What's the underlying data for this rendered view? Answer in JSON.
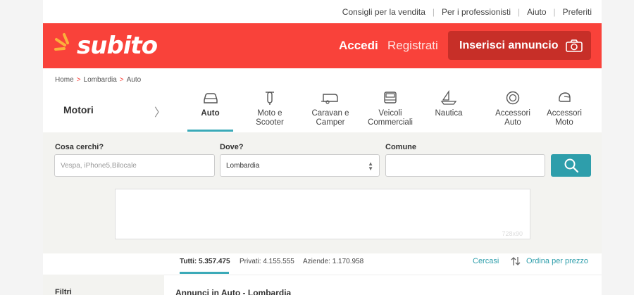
{
  "topbar": {
    "links": [
      "Consigli per la vendita",
      "Per i professionisti",
      "Aiuto",
      "Preferiti"
    ]
  },
  "header": {
    "logo": "subito",
    "login": "Accedi",
    "register": "Registrati",
    "cta": "Inserisci annuncio",
    "bg_color": "#f9423a"
  },
  "breadcrumb": [
    "Home",
    "Lombardia",
    "Auto"
  ],
  "categories": {
    "section": "Motori",
    "items": [
      {
        "label": "Auto",
        "icon": "car-icon",
        "active": true
      },
      {
        "label": "Moto e\nScooter",
        "icon": "scooter-icon"
      },
      {
        "label": "Caravan e\nCamper",
        "icon": "caravan-icon"
      },
      {
        "label": "Veicoli\nCommerciali",
        "icon": "van-icon"
      },
      {
        "label": "Nautica",
        "icon": "boat-icon"
      },
      {
        "label": "Accessori\nAuto",
        "icon": "wheel-icon"
      },
      {
        "label": "Accessori\nMoto",
        "icon": "helmet-icon"
      }
    ]
  },
  "search": {
    "what_label": "Cosa cerchi?",
    "what_placeholder": "Vespa, iPhone5,Bilocale",
    "where_label": "Dove?",
    "where_value": "Lombardia",
    "comune_label": "Comune",
    "comune_value": "",
    "button_color": "#2e9eab"
  },
  "ad": {
    "size": "728x90"
  },
  "stats": {
    "all_label": "Tutti:",
    "all_value": "5.357.475",
    "private_label": "Privati:",
    "private_value": "4.155.555",
    "business_label": "Aziende:",
    "business_value": "1.170.958",
    "save_search": "Cercasi",
    "sort": "Ordina per prezzo"
  },
  "filters_title": "Filtri",
  "results_title": "Annunci in Auto - Lombardia"
}
